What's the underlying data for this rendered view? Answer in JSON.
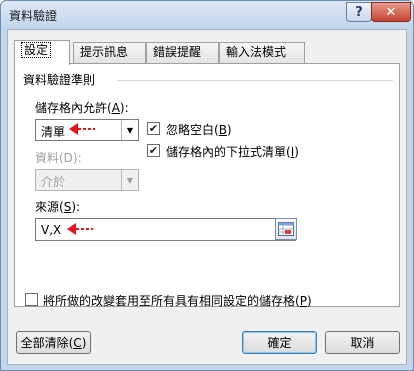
{
  "window": {
    "title": "資料驗證",
    "help_glyph": "?",
    "close_glyph": "✕"
  },
  "tabs": [
    {
      "label": "設定",
      "active": true
    },
    {
      "label": "提示訊息",
      "active": false
    },
    {
      "label": "錯誤提醒",
      "active": false
    },
    {
      "label": "輸入法模式",
      "active": false
    }
  ],
  "settings": {
    "group_title": "資料驗證準則",
    "allow_label": "儲存格內允許(",
    "allow_accel": "A",
    "allow_label_end": "):",
    "allow_value": "清單",
    "data_label": "資料(D):",
    "data_value": "介於",
    "ignore_blank_label": "忽略空白(",
    "ignore_blank_accel": "B",
    "ignore_blank_end": ")",
    "ignore_blank_checked": true,
    "in_cell_dropdown_label": "儲存格內的下拉式清單(",
    "in_cell_dropdown_accel": "I",
    "in_cell_dropdown_end": ")",
    "in_cell_dropdown_checked": true,
    "source_label": "來源(",
    "source_accel": "S",
    "source_label_end": "):",
    "source_value": "V,X",
    "check_glyph": "✔",
    "dropdown_glyph": "▼"
  },
  "apply_all": {
    "label": "將所做的改變套用至所有具有相同設定的儲存格(",
    "accel": "P",
    "label_end": ")",
    "checked": false
  },
  "buttons": {
    "clear_all_label": "全部清除(",
    "clear_all_accel": "C",
    "clear_all_end": ")",
    "ok_label": "確定",
    "cancel_label": "取消"
  },
  "colors": {
    "annotation_arrow": "#e8151b",
    "title_bar": "#c3d6ec",
    "close_button": "#c7452f"
  }
}
